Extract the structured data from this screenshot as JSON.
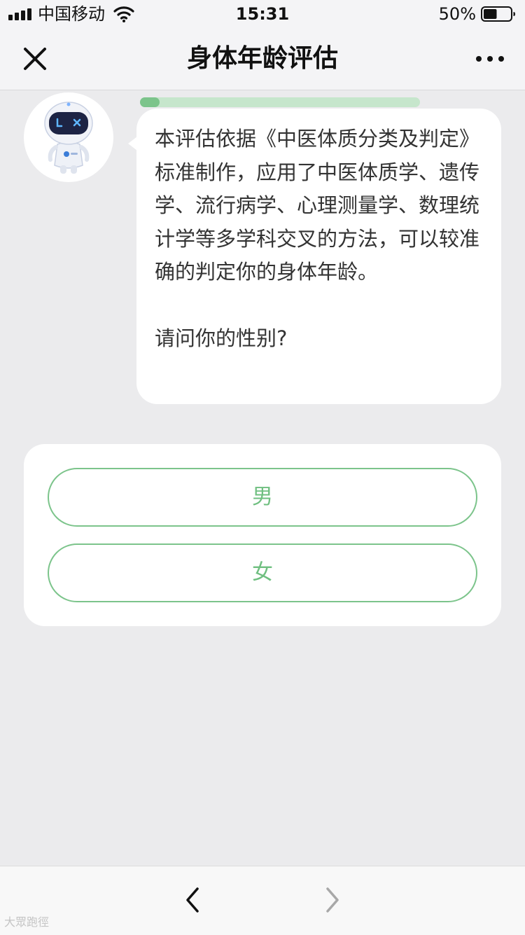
{
  "status_bar": {
    "carrier": "中国移动",
    "time": "15:31",
    "battery": "50%",
    "battery_level": 0.5,
    "signal_icon": "signal-bars-icon",
    "wifi_icon": "wifi-icon",
    "battery_icon": "battery-icon"
  },
  "nav": {
    "title": "身体年龄评估",
    "close_icon": "close-icon",
    "more_icon": "more-icon"
  },
  "chat": {
    "progress": 0.07,
    "avatar_icon": "robot-avatar-icon",
    "message": "本评估依据《中医体质分类及判定》标准制作，应用了中医体质学、遗传学、流行病学、心理测量学、数理统计学等多学科交叉的方法，可以较准确的判定你的身体年龄。",
    "question": "请问你的性别?"
  },
  "options": [
    {
      "label": "男"
    },
    {
      "label": "女"
    }
  ],
  "toolbar": {
    "back_icon": "chevron-left-icon",
    "forward_icon": "chevron-right-icon"
  },
  "watermark": "大眾跑徑",
  "colors": {
    "accent": "#7cc48b",
    "accent_light": "#c6e6cc",
    "background": "#ebebed"
  }
}
